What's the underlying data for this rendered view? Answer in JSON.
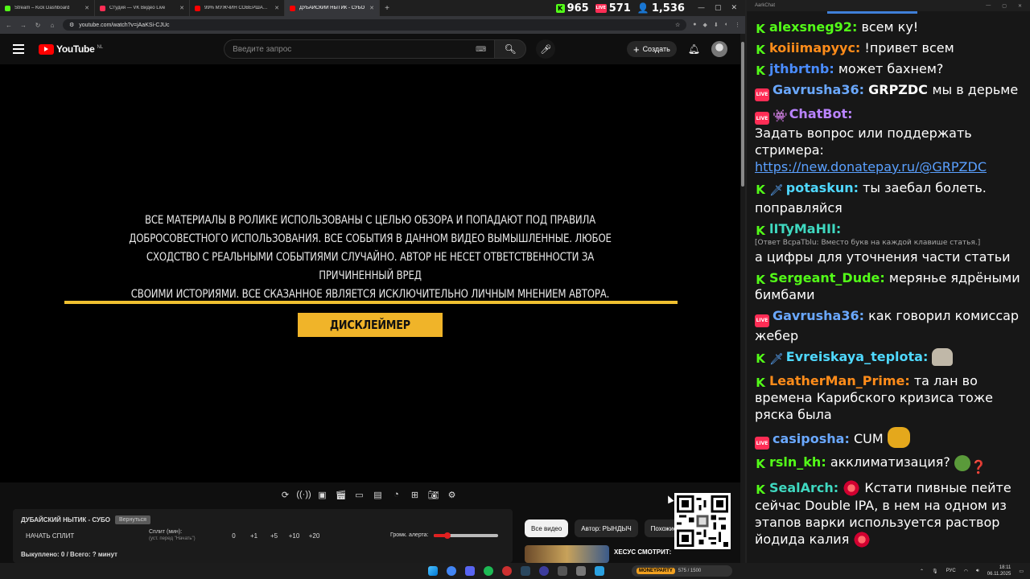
{
  "browser": {
    "tabs": [
      {
        "title": "Stream – Kick Dashboard",
        "color": "#53fc18",
        "active": false
      },
      {
        "title": "Студия — VK Видео Live",
        "color": "#ff2d55",
        "active": false
      },
      {
        "title": "99% МУЖЧИН СОВЕРШАЮТ Э",
        "color": "#ff0000",
        "active": false
      },
      {
        "title": "ДУБАЙСКИЙ НЫТИК - СУБО",
        "color": "#ff0000",
        "active": true
      }
    ],
    "url": "youtube.com/watch?v=jAaKSi-CJUc",
    "stats": {
      "kick": "965",
      "vk": "571",
      "viewers": "1,536"
    }
  },
  "youtube": {
    "logo_text": "YouTube",
    "region": "NL",
    "search_placeholder": "Введите запрос",
    "create_label": "Создать"
  },
  "video": {
    "disclaimer_lines": [
      "ВСЕ МАТЕРИАЛЫ В РОЛИКЕ ИСПОЛЬЗОВАНЫ С ЦЕЛЬЮ ОБЗОРА И ПОПАДАЮТ ПОД ПРАВИЛА",
      "ДОБРОСОВЕСТНОГО ИСПОЛЬЗОВАНИЯ. ВСЕ СОБЫТИЯ В ДАННОМ ВИДЕО ВЫМЫШЛЕННЫЕ. ЛЮБОЕ",
      "СХОДСТВО С РЕАЛЬНЫМИ СОБЫТИЯМИ СЛУЧАЙНО. АВТОР НЕ НЕСЕТ ОТВЕТСТВЕННОСТИ ЗА ПРИЧИНЕННЫЙ ВРЕД",
      "СВОИМИ ИСТОРИЯМИ. ВСЕ СКАЗАННОЕ ЯВЛЯЕТСЯ ИСКЛЮЧИТЕЛЬНО ЛИЧНЫМ МНЕНИЕМ АВТОРА."
    ],
    "button_label": "ДИСКЛЕЙМЕР"
  },
  "split_panel": {
    "title": "ДУБАЙСКИЙ НЫТИК - СУБО",
    "restore_label": "Вернуться",
    "start_label": "НАЧАТЬ СПЛИТ",
    "split_label": "Сплит (мин):",
    "split_sub": "(уст. перед \"Начать\")",
    "values": [
      "0",
      "+1",
      "+5",
      "+10",
      "+20"
    ],
    "alert_label": "Громк. алерта:",
    "alert_level": 0.22,
    "footer": "Выкуплено: 0 / Всего: ? минут"
  },
  "chips": [
    "Все видео",
    "Автор: РЫНДЫЧ",
    "Похожие"
  ],
  "recommended": {
    "title": "ХЕСУС СМОТРИТ:"
  },
  "chat": {
    "window_title": "AarkChat",
    "messages": [
      {
        "badges": [
          "kick"
        ],
        "user": "alexsneg92",
        "color": "#53fc18",
        "text": "всем ку!"
      },
      {
        "badges": [
          "kick"
        ],
        "user": "koiiimapyус",
        "color": "#ff8c1a",
        "text": "!привет всем"
      },
      {
        "badges": [
          "kick"
        ],
        "user": "jthbrtnb",
        "color": "#4a8cff",
        "text": "может бахнем?"
      },
      {
        "badges": [
          "vk"
        ],
        "user": "Gavrusha36",
        "color": "#6aa8ff",
        "bold_text": "GRPZDC",
        "text": "мы в дерьме"
      },
      {
        "badges": [
          "vk",
          "bot"
        ],
        "user": "ChatBot",
        "color": "#b983ff",
        "text": "Задать вопрос или поддержать стримера:",
        "link": "https://new.donatepay.ru/@GRPZDC"
      },
      {
        "badges": [
          "kick",
          "role"
        ],
        "user": "potaskun",
        "color": "#4fd8ff",
        "text": "ты заебал болеть. поправляйся"
      },
      {
        "badges": [
          "kick"
        ],
        "user": "lITyMaHII",
        "color": "#3fd8c0",
        "reply": "[Ответ BcpaTblu: Вместо букв на каждой клавише статья.]",
        "text": "а цифры для уточнения части статьи"
      },
      {
        "badges": [
          "kick"
        ],
        "user": "Sergeant_Dude",
        "color": "#53fc18",
        "text": "мерянье ядрёными бимбами"
      },
      {
        "badges": [
          "vk"
        ],
        "user": "Gavrusha36",
        "color": "#6aa8ff",
        "text": "как говорил комиссар жебер"
      },
      {
        "badges": [
          "kick",
          "role"
        ],
        "user": "Evreiskaya_teplota",
        "color": "#4fd8ff",
        "text": "",
        "emote": "cat"
      },
      {
        "badges": [
          "kick"
        ],
        "user": "LeatherMan_Prime",
        "color": "#ff8c1a",
        "text": "та лан во времена Карибского кризиса тоже ряска была"
      },
      {
        "badges": [
          "vk"
        ],
        "user": "casiposha",
        "color": "#6aa8ff",
        "text": "CUM",
        "emote": "face"
      },
      {
        "badges": [
          "kick"
        ],
        "user": "rsln_kh",
        "color": "#53fc18",
        "text": "акклиматизация?",
        "emote": "frog"
      },
      {
        "badges": [
          "kick"
        ],
        "user": "SealArch",
        "color": "#3fd8c0",
        "text": "Кстати пивные пейте сейчас Double IPA, в нем на одном из этапов варки используется раствор йодида калия",
        "emote": "gem"
      }
    ]
  },
  "taskbar": {
    "counter_logo": "MONEYPARTY",
    "counter_text": "575 / 1500",
    "lang": "РУС",
    "time": "18:11",
    "date": "06.11.2025"
  }
}
